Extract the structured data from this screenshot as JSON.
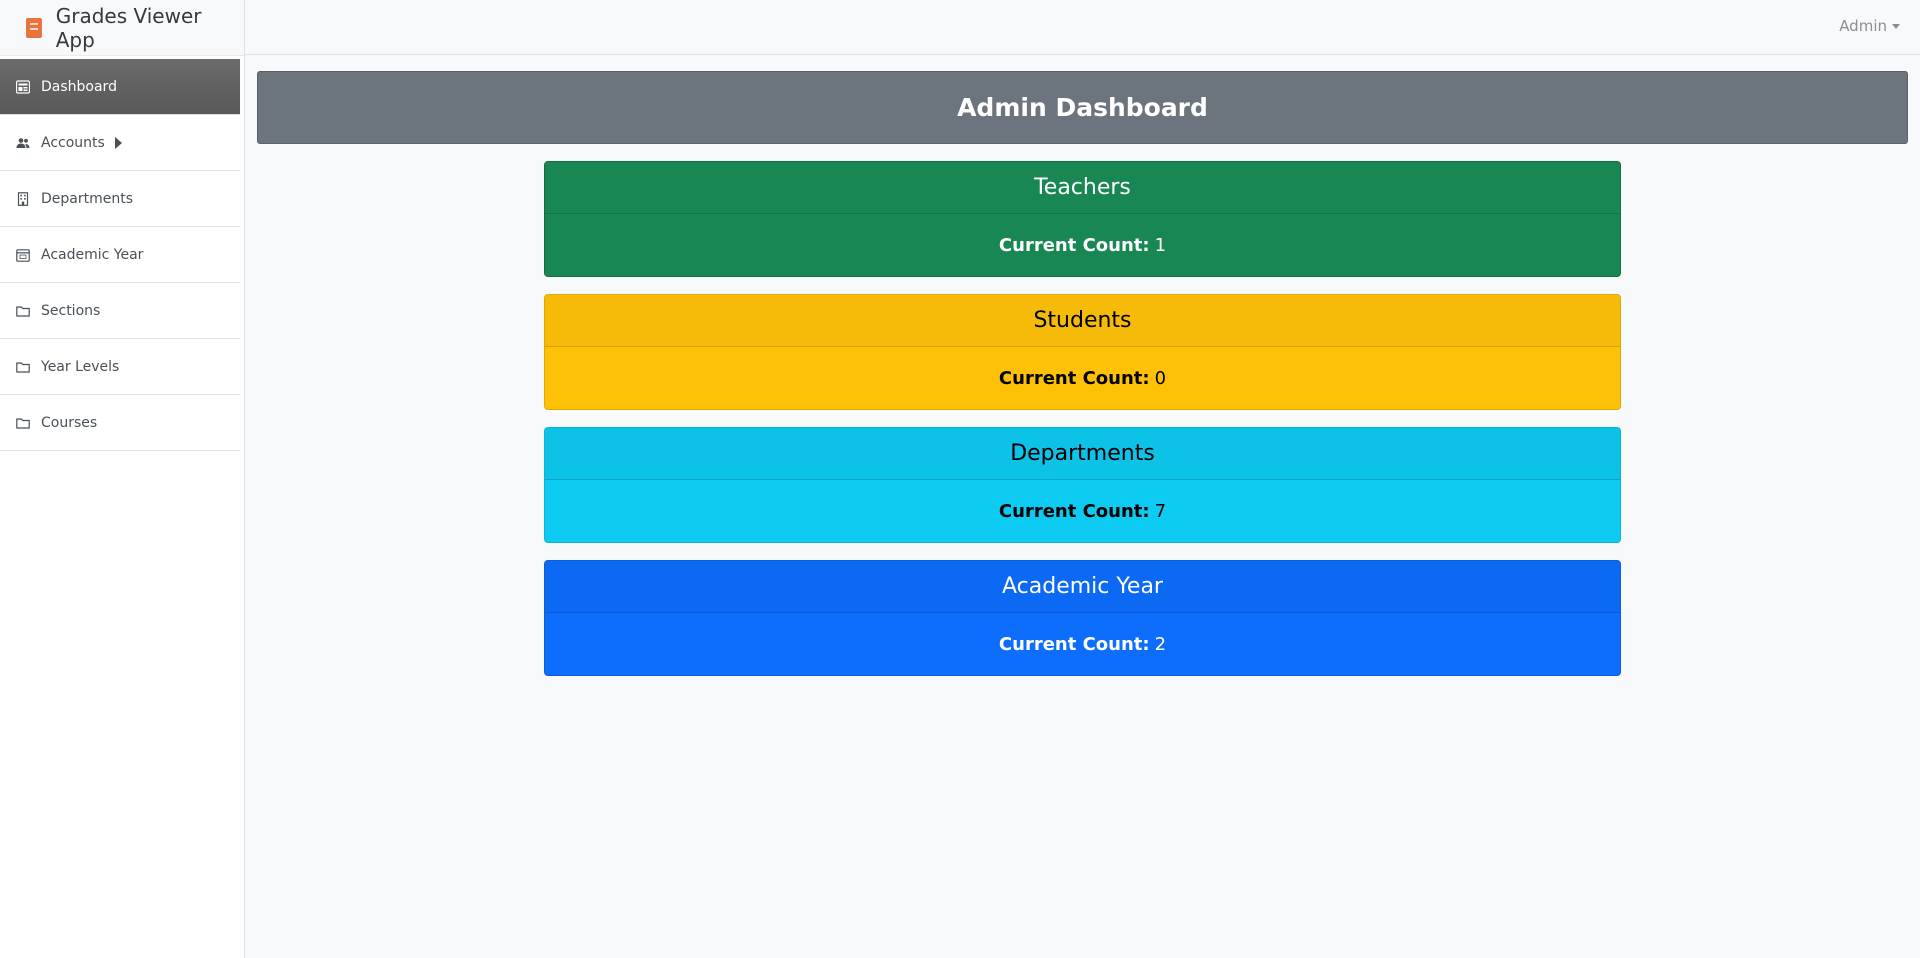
{
  "app": {
    "title": "Grades Viewer App",
    "icon": "notebook-icon"
  },
  "topbar": {
    "user_menu": "Admin"
  },
  "sidebar": {
    "items": [
      {
        "label": "Dashboard",
        "icon": "dashboard-icon",
        "active": true
      },
      {
        "label": "Accounts",
        "icon": "users-icon",
        "has_submenu": true
      },
      {
        "label": "Departments",
        "icon": "building-icon"
      },
      {
        "label": "Academic Year",
        "icon": "calendar-icon"
      },
      {
        "label": "Sections",
        "icon": "folder-icon"
      },
      {
        "label": "Year Levels",
        "icon": "folder-icon"
      },
      {
        "label": "Courses",
        "icon": "folder-icon"
      }
    ]
  },
  "main": {
    "title": "Admin Dashboard",
    "count_label": "Current Count:",
    "cards": [
      {
        "title": "Teachers",
        "count": "1",
        "color": "#198754"
      },
      {
        "title": "Students",
        "count": "0",
        "color": "#ffc107"
      },
      {
        "title": "Departments",
        "count": "7",
        "color": "#0dcaf0"
      },
      {
        "title": "Academic Year",
        "count": "2",
        "color": "#0d6efd"
      }
    ]
  }
}
